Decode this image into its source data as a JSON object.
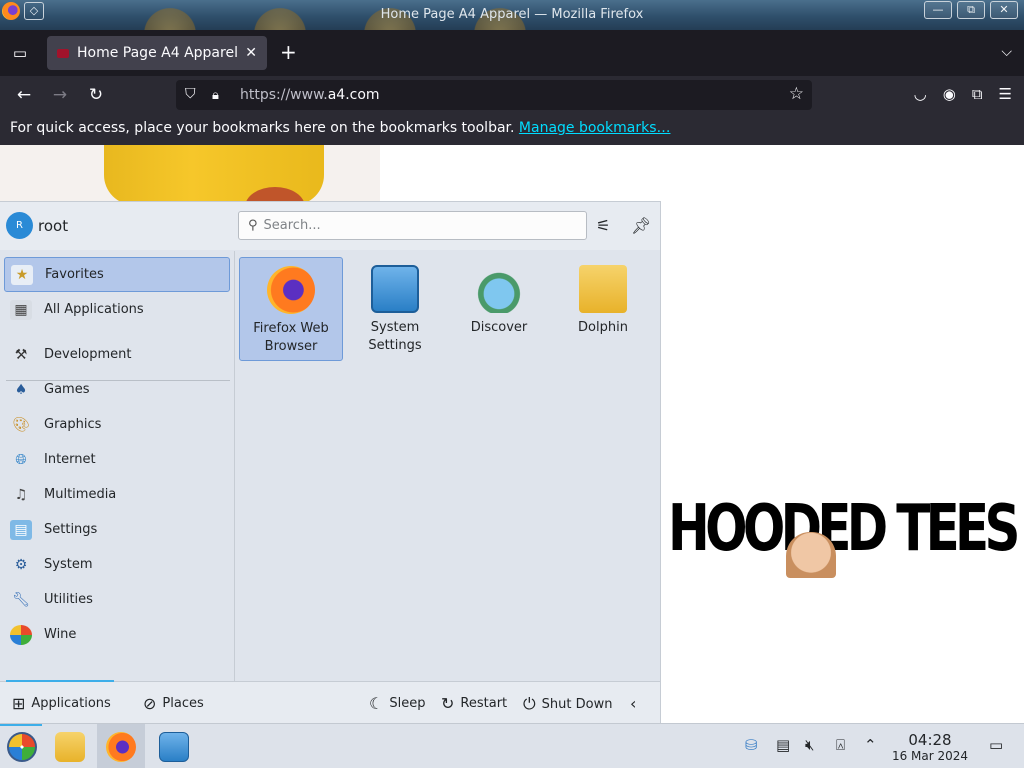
{
  "window": {
    "title": "Home Page A4 Apparel — Mozilla Firefox",
    "pin_glyph": "◇",
    "minimize_glyph": "—",
    "maximize_glyph": "⧉",
    "close_glyph": "✕"
  },
  "browser": {
    "tab_title": "Home Page A4 Apparel",
    "tab_close_glyph": "✕",
    "new_tab_glyph": "+",
    "url_prefix": "https://www.",
    "url_domain": "a4.com",
    "bookmarks_message": "For quick access, place your bookmarks here on the bookmarks toolbar.",
    "bookmarks_link": "Manage bookmarks…"
  },
  "page": {
    "promo_text": "HOODED TEES"
  },
  "launcher": {
    "avatar_initial": "R",
    "username": "root",
    "search_placeholder": "Search...",
    "categories": [
      {
        "label": "Favorites",
        "icon": "favorites-icon",
        "selected": true
      },
      {
        "label": "All Applications",
        "icon": "all-apps-icon"
      },
      {
        "label": "Development",
        "icon": "development-icon"
      },
      {
        "label": "Games",
        "icon": "games-icon"
      },
      {
        "label": "Graphics",
        "icon": "graphics-icon"
      },
      {
        "label": "Internet",
        "icon": "internet-icon"
      },
      {
        "label": "Multimedia",
        "icon": "multimedia-icon"
      },
      {
        "label": "Settings",
        "icon": "settings-icon"
      },
      {
        "label": "System",
        "icon": "system-icon"
      },
      {
        "label": "Utilities",
        "icon": "utilities-icon"
      },
      {
        "label": "Wine",
        "icon": "wine-icon"
      }
    ],
    "apps": [
      {
        "label_line1": "Firefox Web",
        "label_line2": "Browser",
        "icon": "firefox-icon",
        "selected": true
      },
      {
        "label_line1": "System",
        "label_line2": "Settings",
        "icon": "system-settings-icon"
      },
      {
        "label_line1": "Discover",
        "label_line2": "",
        "icon": "discover-icon"
      },
      {
        "label_line1": "Dolphin",
        "label_line2": "",
        "icon": "dolphin-icon"
      }
    ],
    "footer": {
      "applications": "Applications",
      "places": "Places",
      "sleep": "Sleep",
      "restart": "Restart",
      "shutdown": "Shut Down"
    }
  },
  "taskbar": {
    "time": "04:28",
    "date": "16 Mar 2024"
  },
  "colors": {
    "accent": "#3daee9",
    "selection": "#b3c7ea",
    "firefox_dark": "#1c1b22",
    "link": "#00ddff"
  }
}
